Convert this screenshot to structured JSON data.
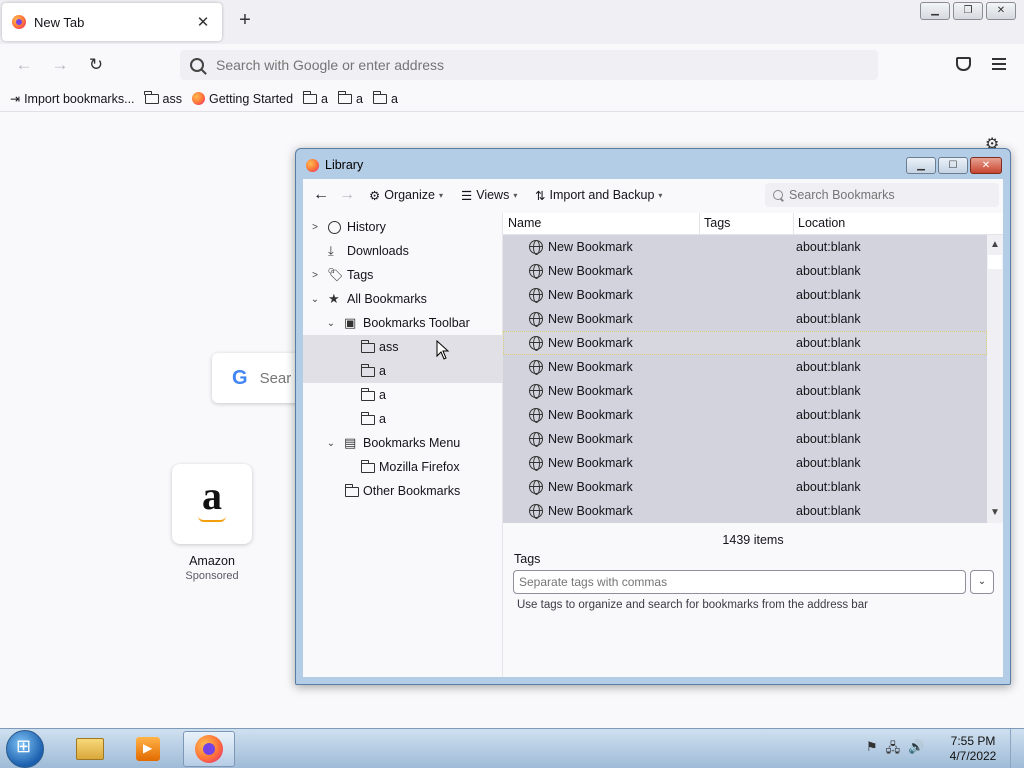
{
  "browser": {
    "tab_title": "New Tab",
    "tab_close": "✕",
    "new_tab": "+",
    "url_placeholder": "Search with Google or enter address",
    "window_controls": [
      "▁",
      "❐",
      "✕"
    ]
  },
  "bookmarks_bar": [
    {
      "icon": "import-icon",
      "label": "Import bookmarks..."
    },
    {
      "icon": "folder-icon",
      "label": "ass"
    },
    {
      "icon": "firefox-icon",
      "label": "Getting Started"
    },
    {
      "icon": "folder-icon",
      "label": "a"
    },
    {
      "icon": "folder-icon",
      "label": "a"
    },
    {
      "icon": "folder-icon",
      "label": "a"
    }
  ],
  "newtab": {
    "search_placeholder": "Sear",
    "tile_label": "Amazon",
    "tile_sub": "Sponsored"
  },
  "library": {
    "title": "Library",
    "toolbar": {
      "organize": "Organize",
      "views": "Views",
      "import_backup": "Import and Backup",
      "search_placeholder": "Search Bookmarks"
    },
    "tree": [
      {
        "label": "History",
        "icon": "clock-icon",
        "twisty": "›",
        "indent": 0
      },
      {
        "label": "Downloads",
        "icon": "download-icon",
        "twisty": "",
        "indent": 0
      },
      {
        "label": "Tags",
        "icon": "tag-icon",
        "twisty": "›",
        "indent": 0
      },
      {
        "label": "All Bookmarks",
        "icon": "star-icon",
        "twisty": "⌄",
        "indent": 0
      },
      {
        "label": "Bookmarks Toolbar",
        "icon": "toolbar-icon",
        "twisty": "⌄",
        "indent": 1
      },
      {
        "label": "ass",
        "icon": "folder-icon",
        "twisty": "",
        "indent": 2
      },
      {
        "label": "a",
        "icon": "folder-icon",
        "twisty": "",
        "indent": 2
      },
      {
        "label": "a",
        "icon": "folder-icon",
        "twisty": "",
        "indent": 2
      },
      {
        "label": "a",
        "icon": "folder-icon",
        "twisty": "",
        "indent": 2
      },
      {
        "label": "Bookmarks Menu",
        "icon": "menu-icon",
        "twisty": "⌄",
        "indent": 1
      },
      {
        "label": "Mozilla Firefox",
        "icon": "folder-icon",
        "twisty": "",
        "indent": 2
      },
      {
        "label": "Other Bookmarks",
        "icon": "folder-icon",
        "twisty": "",
        "indent": 1
      }
    ],
    "columns": {
      "name": "Name",
      "tags": "Tags",
      "location": "Location"
    },
    "rows": [
      {
        "name": "New Bookmark",
        "location": "about:blank"
      },
      {
        "name": "New Bookmark",
        "location": "about:blank"
      },
      {
        "name": "New Bookmark",
        "location": "about:blank"
      },
      {
        "name": "New Bookmark",
        "location": "about:blank"
      },
      {
        "name": "New Bookmark",
        "location": "about:blank"
      },
      {
        "name": "New Bookmark",
        "location": "about:blank"
      },
      {
        "name": "New Bookmark",
        "location": "about:blank"
      },
      {
        "name": "New Bookmark",
        "location": "about:blank"
      },
      {
        "name": "New Bookmark",
        "location": "about:blank"
      },
      {
        "name": "New Bookmark",
        "location": "about:blank"
      },
      {
        "name": "New Bookmark",
        "location": "about:blank"
      },
      {
        "name": "New Bookmark",
        "location": "about:blank"
      },
      {
        "name": "New Bookmark",
        "location": "about:blank"
      }
    ],
    "item_count": "1439 items",
    "tags_label": "Tags",
    "tags_placeholder": "Separate tags with commas",
    "tags_help": "Use tags to organize and search for bookmarks from the address bar"
  },
  "taskbar": {
    "time": "7:55 PM",
    "date": "4/7/2022"
  }
}
